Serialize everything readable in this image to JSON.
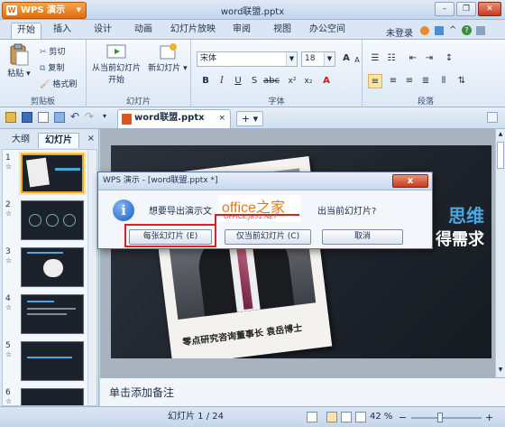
{
  "app": {
    "name": "WPS 演示",
    "window_title": "word联盟.pptx"
  },
  "menu_tabs": [
    {
      "label": "开始",
      "active": true
    },
    {
      "label": "插入"
    },
    {
      "label": "设计"
    },
    {
      "label": "动画"
    },
    {
      "label": "幻灯片放映"
    },
    {
      "label": "审阅"
    },
    {
      "label": "视图"
    },
    {
      "label": "办公空间"
    }
  ],
  "account": {
    "label": "未登录"
  },
  "ribbon": {
    "clipboard": {
      "group_label": "剪贴板",
      "paste": "粘贴",
      "cut": "剪切",
      "copy": "复制",
      "format_painter": "格式刷"
    },
    "slides": {
      "group_label": "幻灯片",
      "from_current_1": "从当前幻灯片",
      "from_current_2": "开始",
      "new_slide": "新幻灯片"
    },
    "font": {
      "group_label": "字体",
      "font_name": "宋体",
      "font_size": "18"
    },
    "paragraph": {
      "group_label": "段落"
    }
  },
  "doc_tab": {
    "label": "word联盟.pptx",
    "new_tab": "+"
  },
  "left_panel": {
    "tabs": [
      {
        "label": "大纲"
      },
      {
        "label": "幻灯片",
        "active": true
      }
    ],
    "slide_numbers": [
      "1",
      "2",
      "3",
      "4",
      "5",
      "6"
    ]
  },
  "slide": {
    "text1": "思维",
    "text2": "得需求",
    "caption": "零点研究咨询董事长 袁岳博士"
  },
  "notes": {
    "placeholder": "单击添加备注"
  },
  "statusbar": {
    "slide_pos": "幻灯片 1 / 24",
    "zoom": "42 %"
  },
  "dialog": {
    "title": "WPS 演示 - [word联盟.pptx *]",
    "message_a": "想要导出演示文",
    "message_b": "出当前幻灯片?",
    "buttons": {
      "each": "每张幻灯片 (E)",
      "current": "仅当前幻灯片 (C)",
      "cancel": "取消"
    },
    "watermark_main": "office之家",
    "watermark_url": "OFFICE.JB51.NET",
    "close": "x"
  }
}
